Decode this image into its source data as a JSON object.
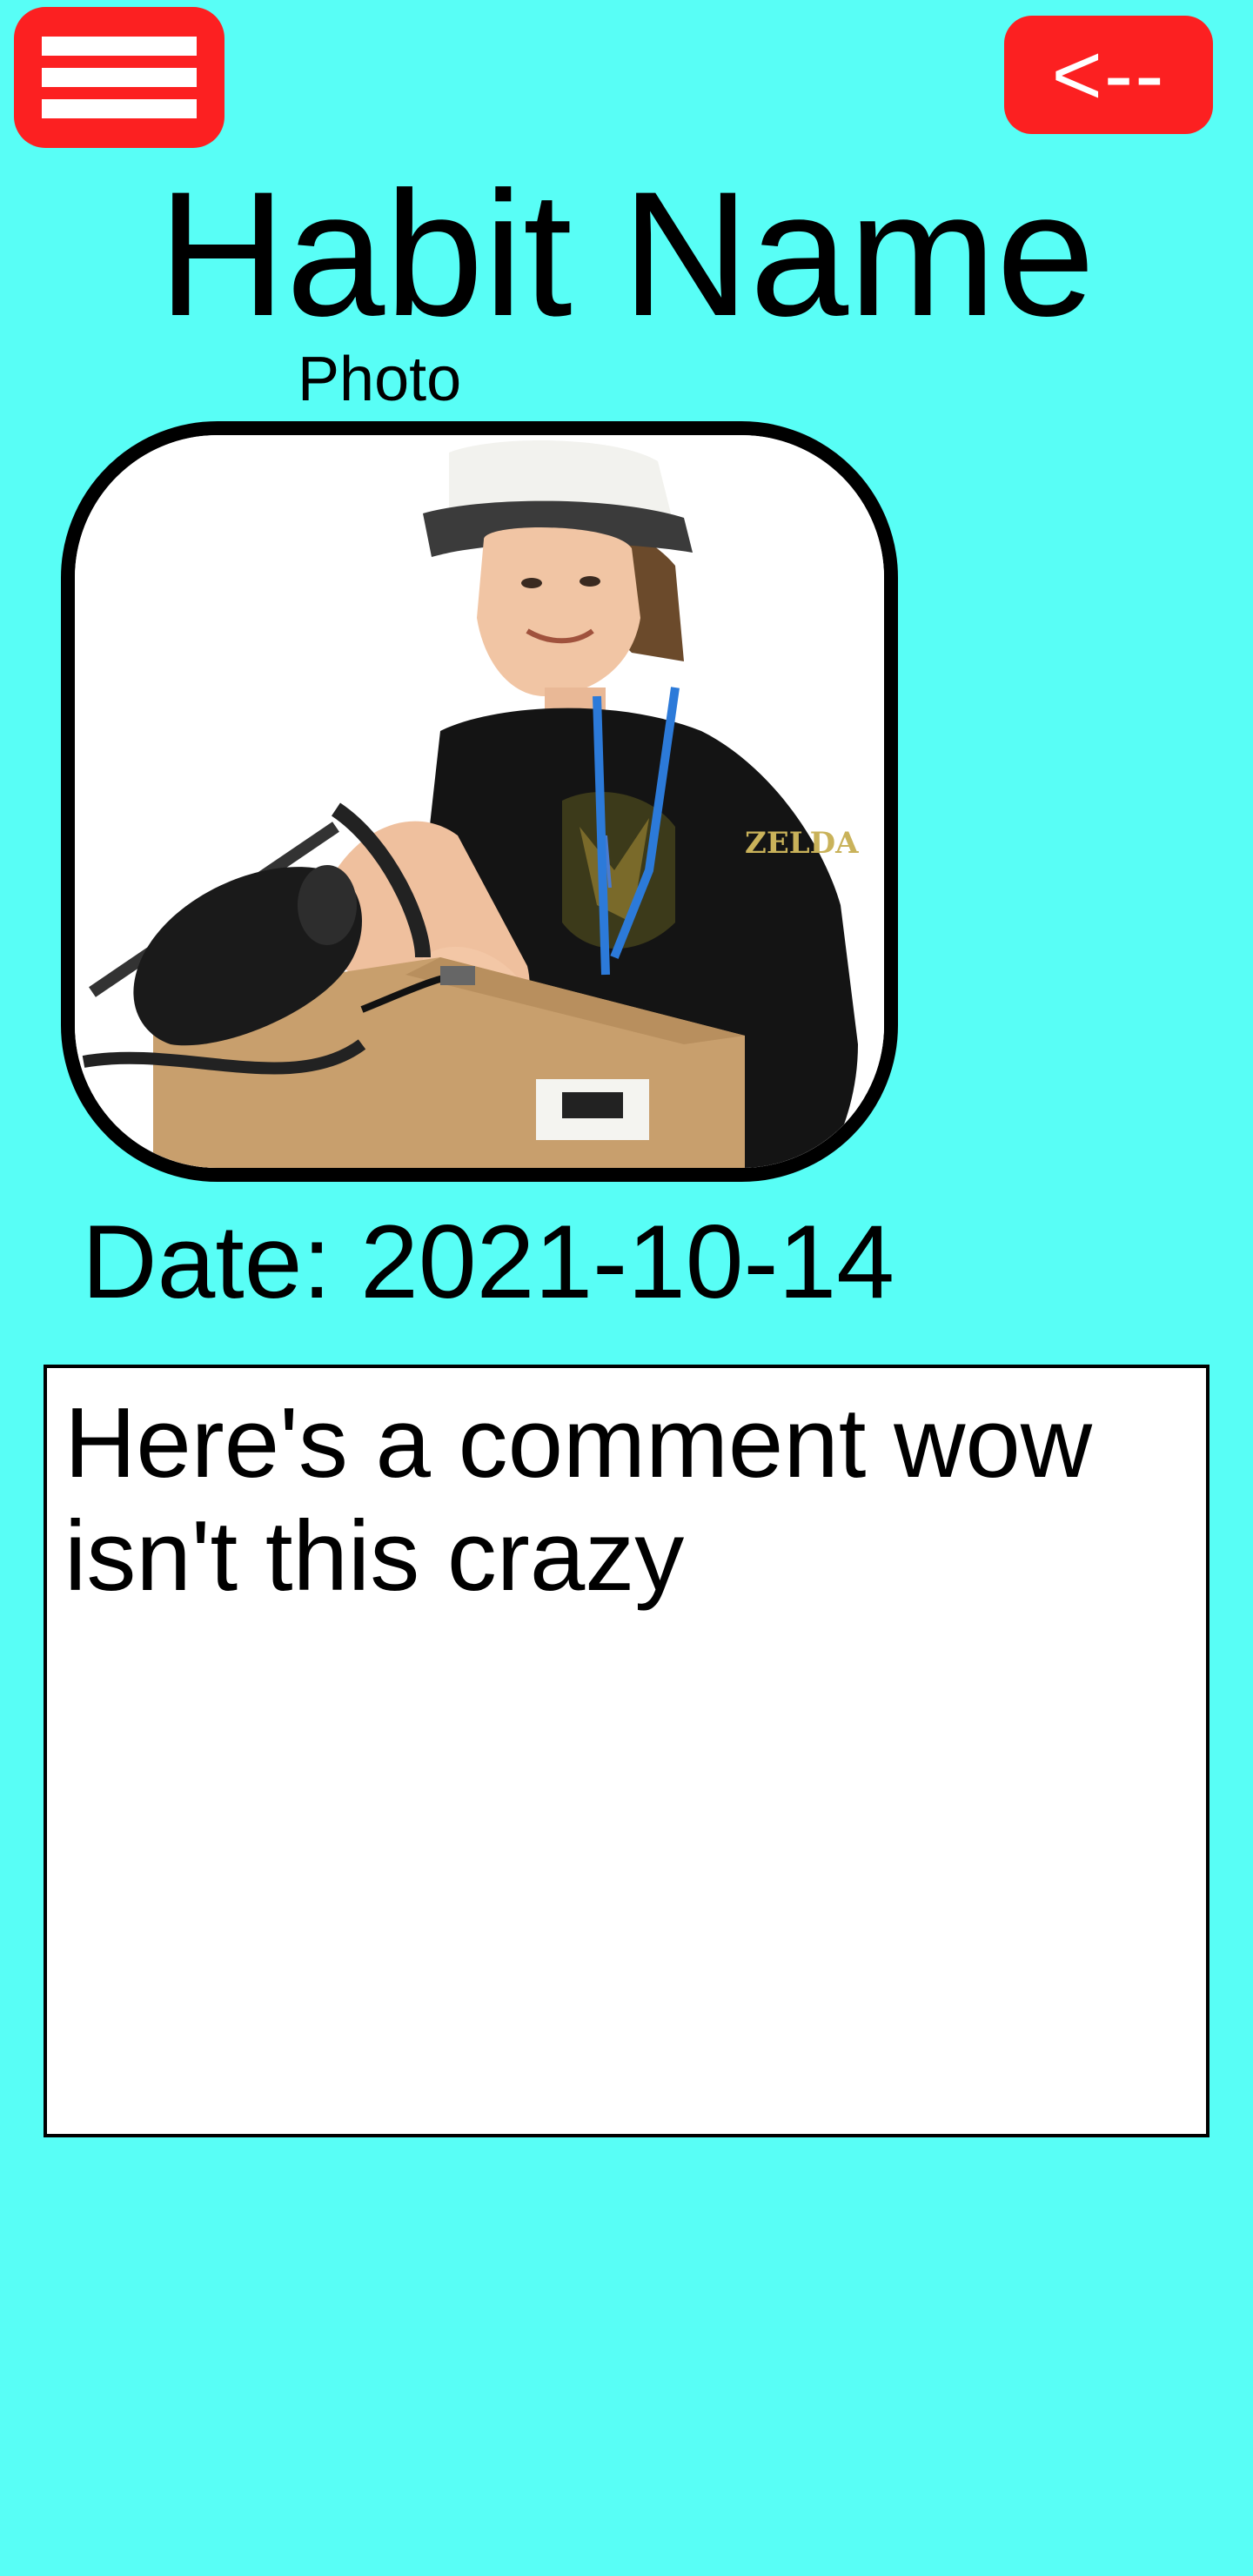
{
  "header": {
    "menu_icon": "hamburger-menu-icon",
    "back_label": "<--"
  },
  "habit": {
    "title": "Habit Name",
    "photo_label": "Photo",
    "date_text": "Date: 2021-10-14",
    "comment": "Here's a comment wow isn't this crazy"
  },
  "colors": {
    "background": "#58fef6",
    "accent_red": "#fc2021"
  }
}
